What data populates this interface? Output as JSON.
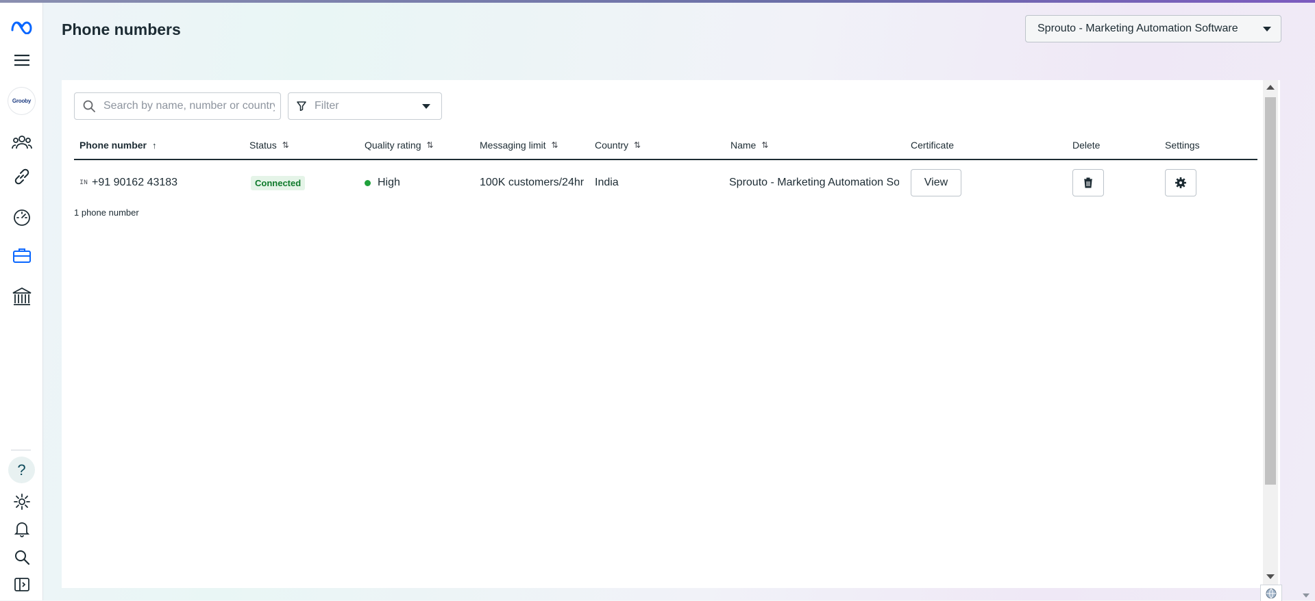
{
  "page": {
    "title": "Phone numbers"
  },
  "account_selector": {
    "label": "Sprouto - Marketing Automation Software"
  },
  "rail": {
    "business_avatar_text": "Grooby",
    "help_label": "?"
  },
  "toolbar": {
    "search_placeholder": "Search by name, number or country",
    "filter_label": "Filter"
  },
  "table": {
    "columns": {
      "phone": "Phone number",
      "status": "Status",
      "quality": "Quality rating",
      "limit": "Messaging limit",
      "country": "Country",
      "name": "Name",
      "certificate": "Certificate",
      "delete": "Delete",
      "settings": "Settings"
    },
    "sort_glyphs": {
      "active": "↑",
      "inactive": "⇅"
    },
    "rows": [
      {
        "country_code": "IN",
        "phone": "+91 90162 43183",
        "status": "Connected",
        "quality": "High",
        "limit": "100K customers/24hr",
        "country": "India",
        "name": "Sprouto - Marketing Automation Software",
        "certificate_button": "View"
      }
    ],
    "count_text": "1 phone number"
  },
  "colors": {
    "brand_meta": "#0866ff",
    "status_connected_bg": "#e5f4e8",
    "status_connected_text": "#0e7a2b",
    "quality_high": "#1fa13b"
  },
  "icons": {
    "rail": [
      "meta-logo-icon",
      "menu-icon",
      "business-avatar",
      "people-icon",
      "link-icon",
      "gauge-icon",
      "briefcase-icon",
      "bank-icon",
      "help-icon",
      "gear-icon",
      "bell-icon",
      "search-icon",
      "panel-toggle-icon"
    ]
  }
}
